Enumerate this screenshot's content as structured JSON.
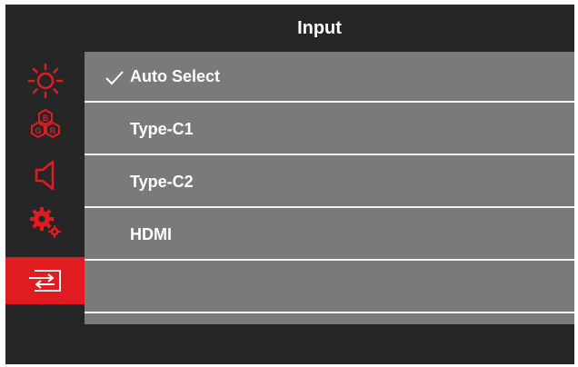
{
  "title": "Input",
  "colors": {
    "accent": "#e01b22",
    "panel": "#7a7a7a",
    "background": "#262626"
  },
  "sidebar": {
    "items": [
      {
        "icon": "brightness-icon",
        "active": false
      },
      {
        "icon": "color-rgb-icon",
        "active": false,
        "letters": [
          "B",
          "G",
          "R"
        ]
      },
      {
        "icon": "speaker-icon",
        "active": false
      },
      {
        "icon": "settings-gears-icon",
        "active": false
      },
      {
        "icon": "input-source-icon",
        "active": true
      }
    ]
  },
  "menu": {
    "items": [
      {
        "label": "Auto Select",
        "checked": true
      },
      {
        "label": "Type-C1",
        "checked": false
      },
      {
        "label": "Type-C2",
        "checked": false
      },
      {
        "label": "HDMI",
        "checked": false
      },
      {
        "label": "",
        "checked": false
      }
    ]
  }
}
